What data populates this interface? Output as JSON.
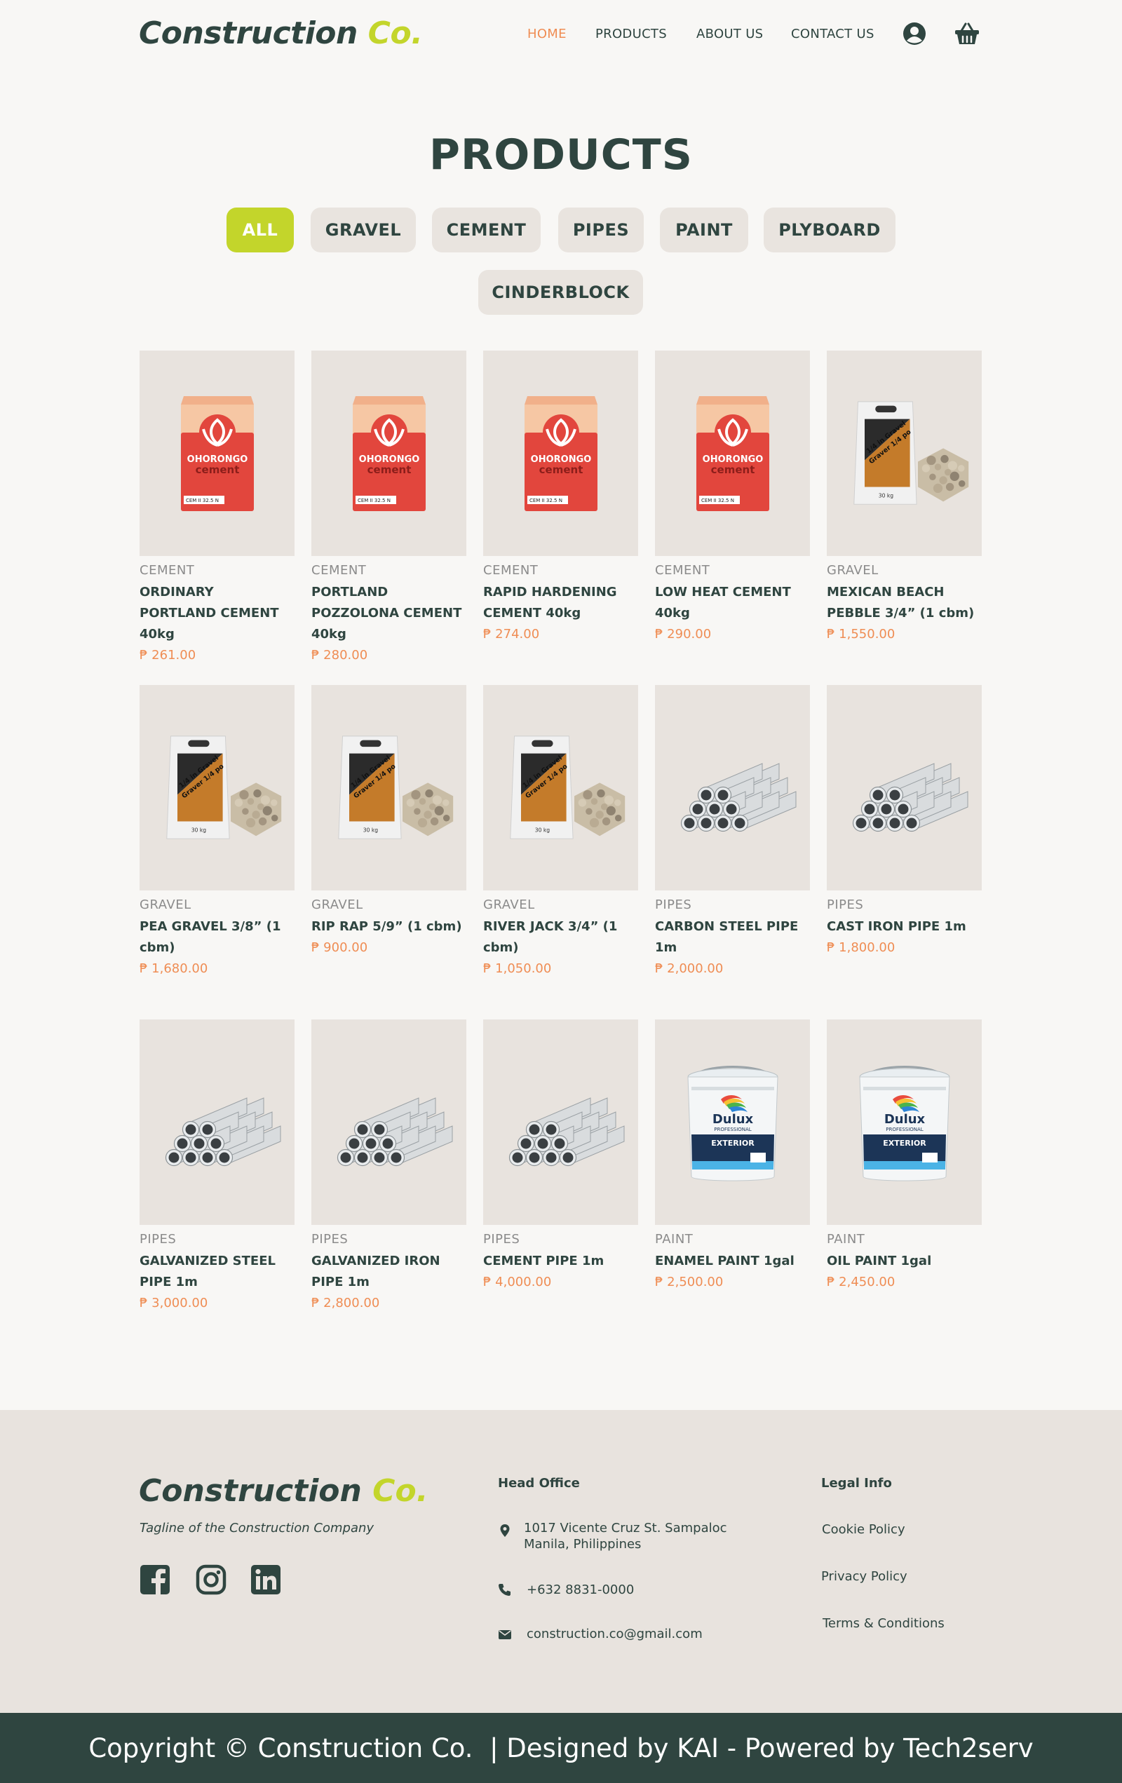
{
  "header": {
    "logo_brand": "Construction",
    "logo_co": "Co.",
    "nav": [
      "HOME",
      "PRODUCTS",
      "ABOUT US",
      "CONTACT US"
    ],
    "active_nav": "HOME"
  },
  "page_title": "PRODUCTS",
  "filters": [
    "ALL",
    "GRAVEL",
    "CEMENT",
    "PIPES",
    "PAINT",
    "PLYBOARD",
    "CINDERBLOCK"
  ],
  "active_filter": "ALL",
  "products": [
    {
      "category": "CEMENT",
      "name": "ORDINARY PORTLAND CEMENT 40kg",
      "price": "₱ 261.00",
      "image": "cement-bag"
    },
    {
      "category": "CEMENT",
      "name": "PORTLAND POZZOLONA CEMENT 40kg",
      "price": "₱ 280.00",
      "image": "cement-bag"
    },
    {
      "category": "CEMENT",
      "name": "RAPID HARDENING CEMENT 40kg",
      "price": "₱ 274.00",
      "image": "cement-bag"
    },
    {
      "category": "CEMENT",
      "name": "LOW HEAT CEMENT 40kg",
      "price": "₱ 290.00",
      "image": "cement-bag"
    },
    {
      "category": "GRAVEL",
      "name": "MEXICAN BEACH PEBBLE 3/4” (1 cbm)",
      "price": "₱ 1,550.00",
      "image": "gravel-bag"
    },
    {
      "category": "GRAVEL",
      "name": "PEA GRAVEL 3/8” (1 cbm)",
      "price": "₱ 1,680.00",
      "image": "gravel-bag"
    },
    {
      "category": "GRAVEL",
      "name": "RIP RAP 5/9” (1 cbm)",
      "price": "₱ 900.00",
      "image": "gravel-bag"
    },
    {
      "category": "GRAVEL",
      "name": "RIVER JACK 3/4” (1 cbm)",
      "price": "₱ 1,050.00",
      "image": "gravel-bag"
    },
    {
      "category": "PIPES",
      "name": "CARBON STEEL PIPE 1m",
      "price": "₱ 2,000.00",
      "image": "pipe-stack"
    },
    {
      "category": "PIPES",
      "name": "CAST IRON PIPE 1m",
      "price": "₱ 1,800.00",
      "image": "pipe-stack"
    },
    {
      "category": "PIPES",
      "name": "GALVANIZED STEEL PIPE 1m",
      "price": "₱ 3,000.00",
      "image": "pipe-stack"
    },
    {
      "category": "PIPES",
      "name": "GALVANIZED IRON PIPE 1m",
      "price": "₱ 2,800.00",
      "image": "pipe-stack"
    },
    {
      "category": "PIPES",
      "name": "CEMENT PIPE 1m",
      "price": "₱ 4,000.00",
      "image": "pipe-stack"
    },
    {
      "category": "PAINT",
      "name": "ENAMEL PAINT 1gal",
      "price": "₱ 2,500.00",
      "image": "paint-bucket"
    },
    {
      "category": "PAINT",
      "name": "OIL PAINT 1gal",
      "price": "₱ 2,450.00",
      "image": "paint-bucket"
    }
  ],
  "product_art": {
    "cement_brand": "OHORONGO",
    "cement_word": "cement",
    "cement_grade": "CEM II 32.5 N",
    "gravel_text_1": "1/4 in Gravel",
    "gravel_text_2": "Graver 1/4 po",
    "gravel_weight": "30 kg",
    "paint_brand": "Dulux",
    "paint_sub": "PROFESSIONAL",
    "paint_type": "EXTERIOR"
  },
  "footer": {
    "logo_brand": "Construction",
    "logo_co": "Co.",
    "tagline": "Tagline of the Construction Company",
    "head_office_title": "Head Office",
    "address_line1": "1017 Vicente Cruz St. Sampaloc",
    "address_line2": "Manila, Philippines",
    "phone": "+632 8831-0000",
    "email": "construction.co@gmail.com",
    "legal_title": "Legal Info",
    "legal_links": [
      "Cookie Policy",
      "Privacy Policy",
      "Terms & Conditions"
    ]
  },
  "copyright": "Copyright © Construction Co.  | Designed by KAI - Powered by Tech2serv",
  "colors": {
    "primary": "#2f4540",
    "accent_lime": "#c3d52b",
    "accent_orange": "#ef8d54",
    "card_bg": "#e8e3de",
    "page_bg": "#f8f7f5"
  }
}
